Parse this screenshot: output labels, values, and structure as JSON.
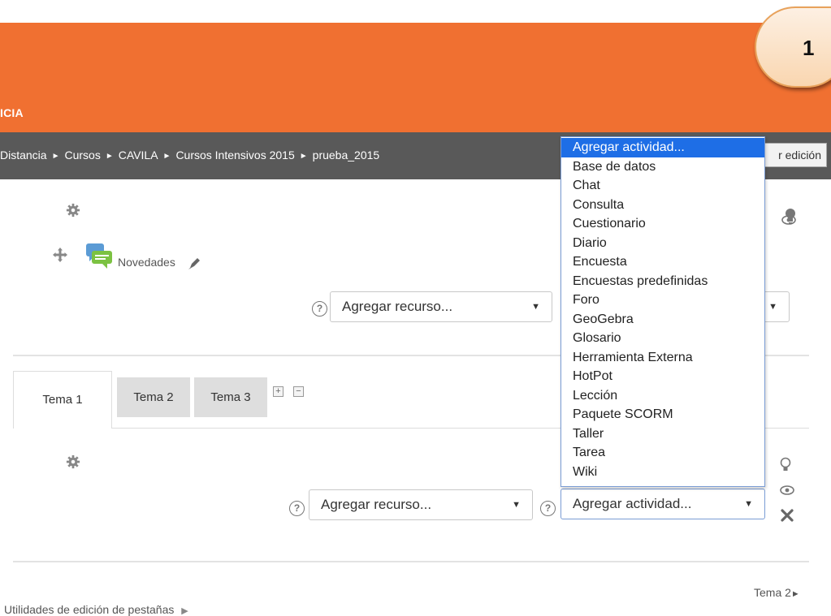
{
  "header": {
    "site_name": "ICIA",
    "badge_number": "1"
  },
  "breadcrumb": {
    "items": [
      "Distancia",
      "Cursos",
      "CAVILA",
      "Cursos Intensivos 2015",
      "prueba_2015"
    ],
    "separator": "►"
  },
  "toolbar": {
    "edit_button_label": "r edición"
  },
  "section0": {
    "forum_label": "Novedades",
    "add_resource": "Agregar recurso..."
  },
  "tabs": [
    "Tema 1",
    "Tema 2",
    "Tema 3"
  ],
  "section1": {
    "add_resource": "Agregar recurso...",
    "add_activity": "Agregar actividad..."
  },
  "activity_dropdown": {
    "options": [
      "Agregar actividad...",
      "Base de datos",
      "Chat",
      "Consulta",
      "Cuestionario",
      "Diario",
      "Encuesta",
      "Encuestas predefinidas",
      "Foro",
      "GeoGebra",
      "Glosario",
      "Herramienta Externa",
      "HotPot",
      "Lección",
      "Paquete SCORM",
      "Taller",
      "Tarea",
      "Wiki"
    ],
    "selected_index": 0
  },
  "footer": {
    "next_link": "Tema 2",
    "next_arrow": "►",
    "tab_utilities": "Utilidades de edición de pestañas",
    "tab_utilities_arrow": "▶"
  },
  "colors": {
    "header_orange": "#f07031",
    "nav_gray": "#595959",
    "selection_blue": "#1e6ee6"
  }
}
